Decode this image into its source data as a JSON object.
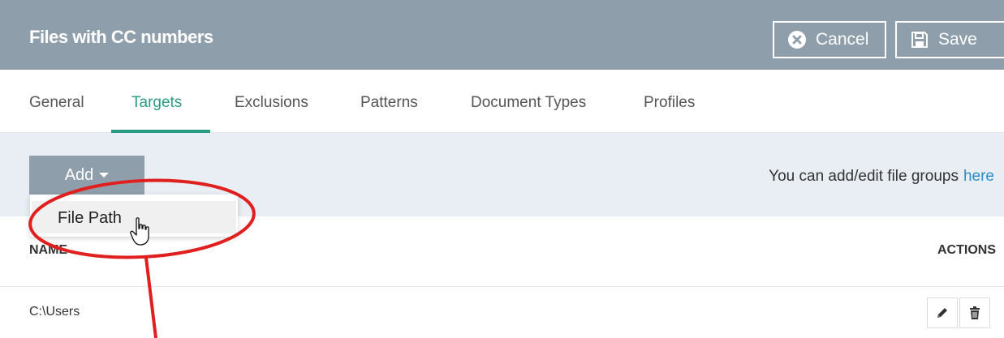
{
  "header": {
    "title": "Files with CC numbers",
    "cancel_label": "Cancel",
    "save_label": "Save",
    "background": "#8f9eab"
  },
  "tabs": [
    {
      "label": "General",
      "active": false
    },
    {
      "label": "Targets",
      "active": true
    },
    {
      "label": "Exclusions",
      "active": false
    },
    {
      "label": "Patterns",
      "active": false
    },
    {
      "label": "Document Types",
      "active": false
    },
    {
      "label": "Profiles",
      "active": false
    }
  ],
  "toolbar": {
    "add_label": "Add",
    "hint_text": "You can add/edit file groups",
    "hint_link": "here"
  },
  "dropdown": {
    "items": [
      "File Path"
    ]
  },
  "table": {
    "columns": [
      "NAME",
      "ACTIONS"
    ],
    "rows": [
      {
        "name": "C:\\Users"
      }
    ]
  },
  "icons": {
    "cancel": "close-circle-icon",
    "save": "floppy-disk-icon",
    "caret": "caret-down-icon",
    "edit": "pencil-icon",
    "delete": "trash-icon",
    "cursor": "hand-pointer-icon"
  },
  "colors": {
    "accent": "#2a9a82",
    "link": "#2d8cc8",
    "annotation": "#e0201f"
  }
}
